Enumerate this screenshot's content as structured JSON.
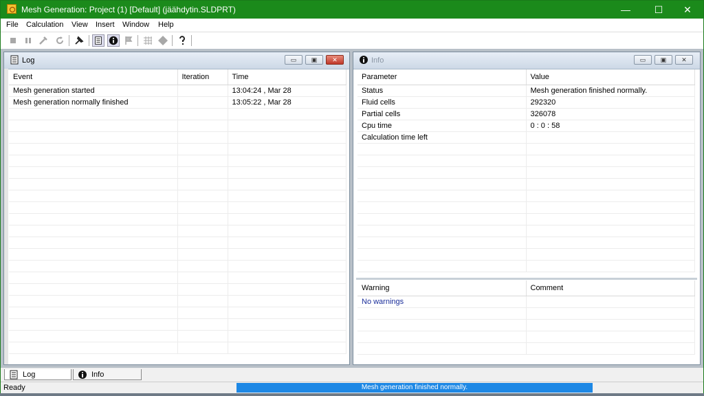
{
  "titlebar": {
    "title": "Mesh Generation: Project (1) [Default] (jäähdytin.SLDPRT)",
    "minimize": "—",
    "maximize": "☐",
    "close": "✕"
  },
  "menu": [
    "File",
    "Calculation",
    "View",
    "Insert",
    "Window",
    "Help"
  ],
  "toolbar": [
    {
      "icon": "stop-icon",
      "glyph": "■"
    },
    {
      "icon": "pause-icon",
      "glyph": "❚❚"
    },
    {
      "icon": "wrench-icon",
      "glyph": "✂"
    },
    {
      "icon": "refresh-icon",
      "glyph": "↻"
    },
    {
      "icon": "pin-icon",
      "glyph": "✎"
    },
    {
      "icon": "log-icon",
      "glyph": "▤"
    },
    {
      "icon": "info-icon",
      "glyph": "ℹ"
    },
    {
      "icon": "flag-icon",
      "glyph": "⚑"
    },
    {
      "icon": "mesh-icon",
      "glyph": "▦"
    },
    {
      "icon": "diamond-icon",
      "glyph": "◈"
    },
    {
      "icon": "help-icon",
      "glyph": "?"
    }
  ],
  "log_panel": {
    "title": "Log",
    "columns": [
      "Event",
      "Iteration",
      "Time"
    ],
    "rows": [
      [
        "Mesh generation started",
        "",
        "13:04:24 , Mar 28"
      ],
      [
        "Mesh generation normally finished",
        "",
        "13:05:22 , Mar 28"
      ]
    ]
  },
  "info_panel": {
    "title": "Info",
    "columns": [
      "Parameter",
      "Value"
    ],
    "rows": [
      [
        "Status",
        "Mesh generation finished normally."
      ],
      [
        "Fluid cells",
        "292320"
      ],
      [
        "Partial cells",
        "326078"
      ],
      [
        "Cpu time",
        "0 : 0 : 58"
      ],
      [
        "Calculation time left",
        ""
      ]
    ],
    "warn_columns": [
      "Warning",
      "Comment"
    ],
    "warnings": "No warnings"
  },
  "tabs": [
    "Log",
    "Info"
  ],
  "status": {
    "text": "Ready",
    "progress_text": "Mesh generation finished normally.",
    "progress_fraction": 1.0
  },
  "colors": {
    "title_green": "#1b8a1b",
    "progress_blue": "#1e88e5",
    "warning_blue": "#1a2e9a"
  }
}
